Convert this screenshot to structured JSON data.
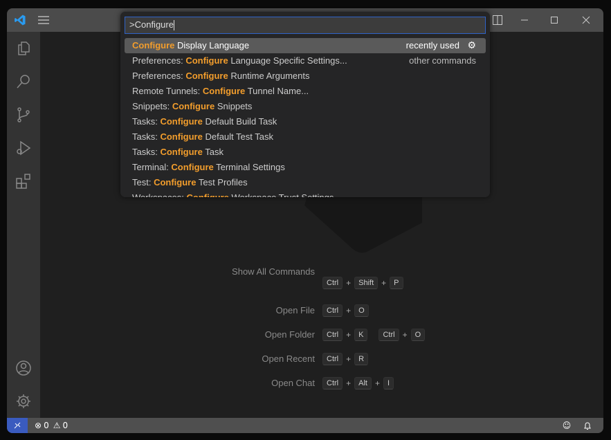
{
  "quick_pick": {
    "input_value": ">Configure",
    "items": [
      {
        "prefix": "",
        "match": "Configure",
        "suffix": " Display Language",
        "right": "recently used",
        "selected": true
      },
      {
        "prefix": "Preferences: ",
        "match": "Configure",
        "suffix": " Language Specific Settings...",
        "right": "other commands"
      },
      {
        "prefix": "Preferences: ",
        "match": "Configure",
        "suffix": " Runtime Arguments",
        "right": ""
      },
      {
        "prefix": "Remote Tunnels: ",
        "match": "Configure",
        "suffix": " Tunnel Name...",
        "right": ""
      },
      {
        "prefix": "Snippets: ",
        "match": "Configure",
        "suffix": " Snippets",
        "right": ""
      },
      {
        "prefix": "Tasks: ",
        "match": "Configure",
        "suffix": " Default Build Task",
        "right": ""
      },
      {
        "prefix": "Tasks: ",
        "match": "Configure",
        "suffix": " Default Test Task",
        "right": ""
      },
      {
        "prefix": "Tasks: ",
        "match": "Configure",
        "suffix": " Task",
        "right": ""
      },
      {
        "prefix": "Terminal: ",
        "match": "Configure",
        "suffix": " Terminal Settings",
        "right": ""
      },
      {
        "prefix": "Test: ",
        "match": "Configure",
        "suffix": " Test Profiles",
        "right": ""
      },
      {
        "prefix": "Workspaces: ",
        "match": "Configure",
        "suffix": " Workspace Trust Settings",
        "right": ""
      }
    ]
  },
  "shortcuts": [
    {
      "label": "Show All Commands",
      "keys": [
        [
          "Ctrl",
          "Shift",
          "P"
        ]
      ]
    },
    {
      "label": "Open File",
      "keys": [
        [
          "Ctrl",
          "O"
        ]
      ]
    },
    {
      "label": "Open Folder",
      "keys": [
        [
          "Ctrl",
          "K"
        ],
        [
          "Ctrl",
          "O"
        ]
      ]
    },
    {
      "label": "Open Recent",
      "keys": [
        [
          "Ctrl",
          "R"
        ]
      ]
    },
    {
      "label": "Open Chat",
      "keys": [
        [
          "Ctrl",
          "Alt",
          "I"
        ]
      ]
    }
  ],
  "status": {
    "errors": "0",
    "warnings": "0"
  },
  "colors": {
    "accent": "#f29d2c",
    "remote": "#3a5bbf",
    "focus": "#2f63c7"
  }
}
